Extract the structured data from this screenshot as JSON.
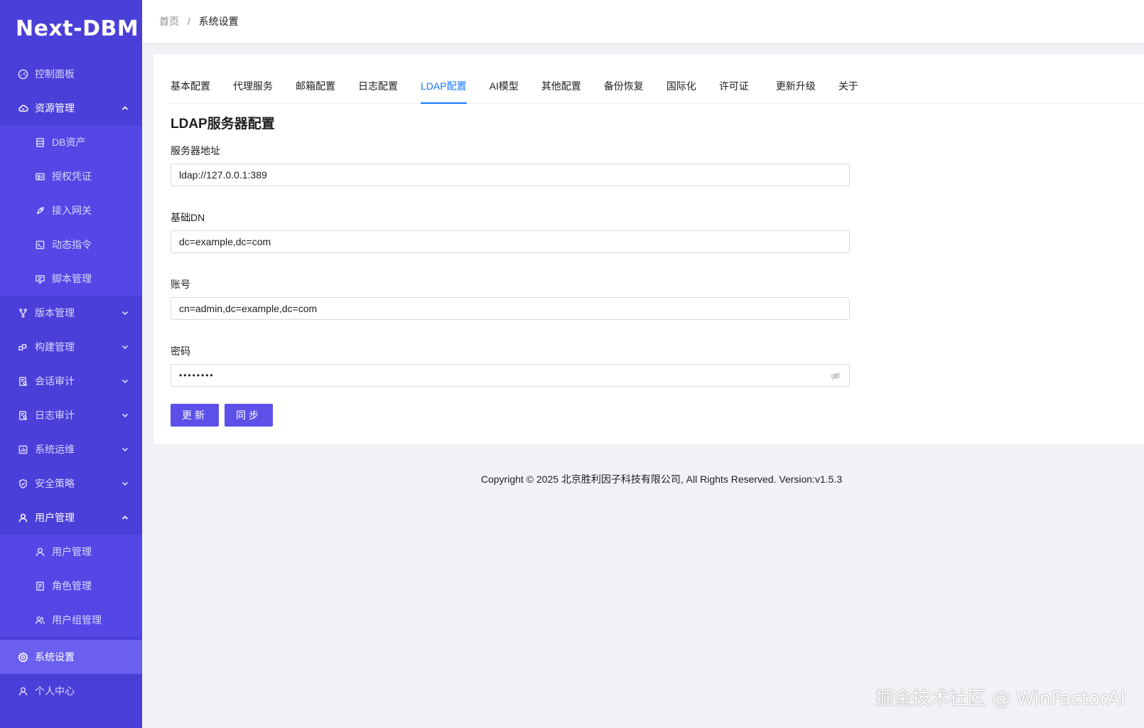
{
  "app": {
    "logo": "Next-DBM"
  },
  "sidebar": {
    "items": [
      {
        "label": "控制面板",
        "icon": "dashboard-icon"
      },
      {
        "label": "资源管理",
        "icon": "cloud-icon",
        "expanded": true,
        "children": [
          {
            "label": "DB资产",
            "icon": "database-icon"
          },
          {
            "label": "授权凭证",
            "icon": "id-card-icon"
          },
          {
            "label": "接入网关",
            "icon": "rocket-icon"
          },
          {
            "label": "动态指令",
            "icon": "terminal-icon"
          },
          {
            "label": "脚本管理",
            "icon": "monitor-icon"
          }
        ]
      },
      {
        "label": "版本管理",
        "icon": "branch-icon"
      },
      {
        "label": "构建管理",
        "icon": "build-icon"
      },
      {
        "label": "会话审计",
        "icon": "audit-icon"
      },
      {
        "label": "日志审计",
        "icon": "log-icon"
      },
      {
        "label": "系统运维",
        "icon": "ops-icon"
      },
      {
        "label": "安全策略",
        "icon": "shield-icon"
      },
      {
        "label": "用户管理",
        "icon": "user-icon",
        "expanded": true,
        "children": [
          {
            "label": "用户管理",
            "icon": "user-icon"
          },
          {
            "label": "角色管理",
            "icon": "role-icon"
          },
          {
            "label": "用户组管理",
            "icon": "group-icon"
          }
        ]
      },
      {
        "label": "系统设置",
        "icon": "gear-icon",
        "active": true
      },
      {
        "label": "个人中心",
        "icon": "user-icon"
      }
    ]
  },
  "breadcrumb": {
    "home": "首页",
    "separator": "/",
    "current": "系统设置"
  },
  "tabs": {
    "items": [
      "基本配置",
      "代理服务",
      "邮箱配置",
      "日志配置",
      "LDAP配置",
      "AI模型",
      "其他配置",
      "备份恢复",
      "国际化",
      "许可证",
      "更新升级",
      "关于"
    ],
    "active": "LDAP配置"
  },
  "ldap": {
    "title": "LDAP服务器配置",
    "server_label": "服务器地址",
    "server_value": "ldap://127.0.0.1:389",
    "base_dn_label": "基础DN",
    "base_dn_value": "dc=example,dc=com",
    "account_label": "账号",
    "account_value": "cn=admin,dc=example,dc=com",
    "password_label": "密码",
    "password_value": "••••••••",
    "update_button": "更新",
    "sync_button": "同步"
  },
  "footer": {
    "text": "Copyright © 2025 北京胜利因子科技有限公司, All Rights Reserved. Version:v1.5.3"
  },
  "watermark": {
    "text": "掘金技术社区 @ WinFactorAI"
  },
  "colors": {
    "sidebar": "#4a3fd8",
    "submenu": "#5447e6",
    "active_item": "#6b5ff0",
    "accent": "#1677ff",
    "button": "#5d50e8"
  }
}
